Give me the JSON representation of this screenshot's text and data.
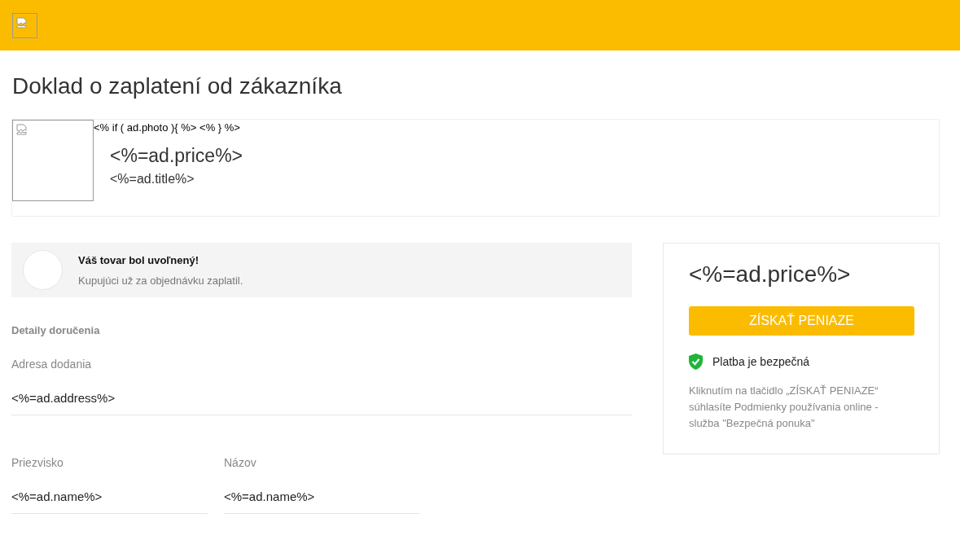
{
  "page_title": "Doklad o zaplatení od zákazníka",
  "product": {
    "template_line": "<% if ( ad.photo ){ %> <% } %>",
    "price": "<%=ad.price%>",
    "title": "<%=ad.title%>"
  },
  "notice": {
    "title": "Váš tovar bol uvoľnený!",
    "text": "Kupujúci už za objednávku zaplatil."
  },
  "delivery": {
    "heading": "Detaily doručenia",
    "fields": [
      {
        "label": "Adresa dodania",
        "value": "<%=ad.address%>",
        "kind": "full"
      },
      {
        "label": "Priezvisko",
        "value": "<%=ad.name%>",
        "kind": "half"
      },
      {
        "label": "Názov",
        "value": "<%=ad.name%>",
        "kind": "half"
      }
    ]
  },
  "summary": {
    "price": "<%=ad.price%>",
    "button": "ZÍSKAŤ PENIAZE",
    "secure": "Platba je bezpečná",
    "terms": "Kliknutím na tlačidlo „ZÍSKAŤ PENIAZE“ súhlasíte Podmienky používania online - služba \"Bezpečná ponuka\""
  }
}
